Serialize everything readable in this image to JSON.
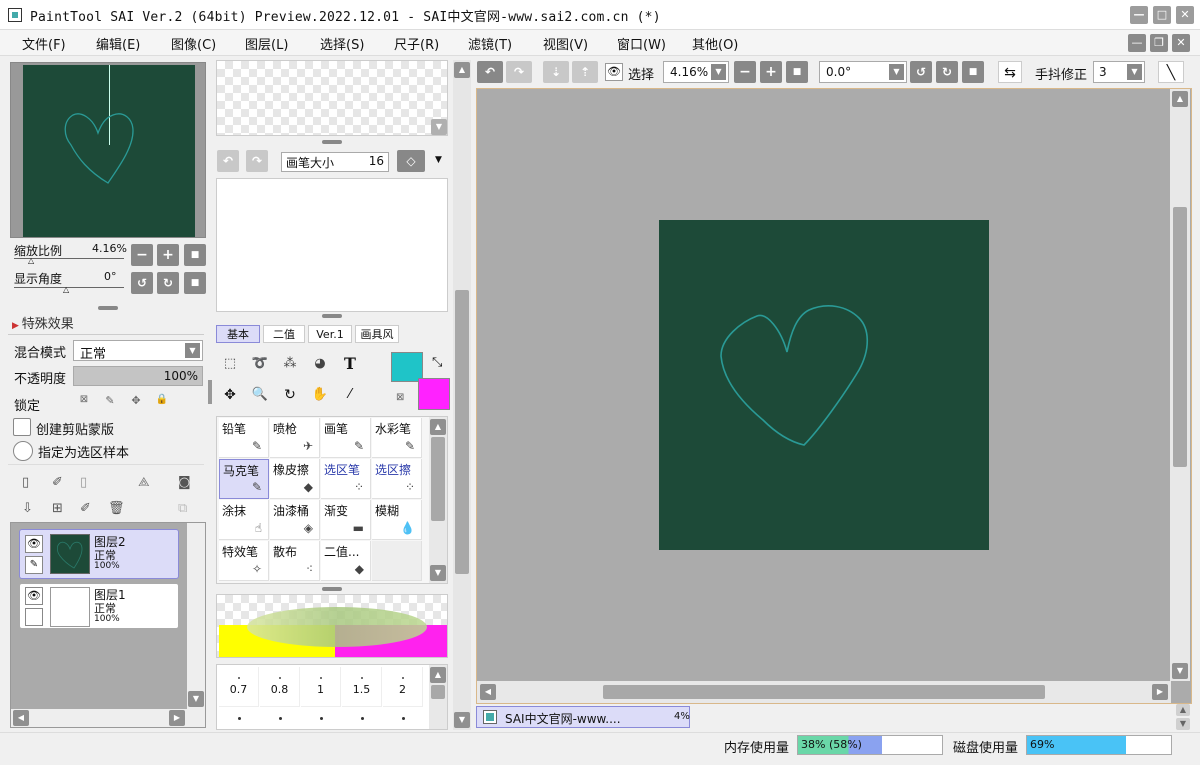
{
  "window": {
    "title": "PaintTool SAI Ver.2 (64bit) Preview.2022.12.01 - SAI中文官网-www.sai2.com.cn (*)"
  },
  "menu": {
    "items": [
      "文件(F)",
      "编辑(E)",
      "图像(C)",
      "图层(L)",
      "选择(S)",
      "尺子(R)",
      "滤镜(T)",
      "视图(V)",
      "窗口(W)",
      "其他(O)"
    ]
  },
  "navigator": {
    "zoom_label": "缩放比例",
    "zoom_value": "4.16%",
    "angle_label": "显示角度",
    "angle_value": "0°"
  },
  "layer_props": {
    "effects_label": "特殊效果",
    "blend_label": "混合模式",
    "blend_value": "正常",
    "opacity_label": "不透明度",
    "opacity_value": "100%",
    "lock_label": "锁定",
    "clip_label": "创建剪贴蒙版",
    "sample_label": "指定为选区样本"
  },
  "layers": [
    {
      "name": "图层2",
      "mode": "正常",
      "opacity": "100%",
      "selected": true
    },
    {
      "name": "图层1",
      "mode": "正常",
      "opacity": "100%",
      "selected": false
    }
  ],
  "brush": {
    "size_label": "画笔大小",
    "size_value": "16"
  },
  "tabs": [
    "基本",
    "二值",
    "Ver.1",
    "画具风"
  ],
  "colors": {
    "primary": "#1fc4c8",
    "secondary": "#ff22ff",
    "canvas": "#1d4a38",
    "heart": "#2a9a96"
  },
  "tools": [
    {
      "name": "铅笔",
      "icon": "✎"
    },
    {
      "name": "喷枪",
      "icon": "✈"
    },
    {
      "name": "画笔",
      "icon": "✎"
    },
    {
      "name": "水彩笔",
      "icon": "✎"
    },
    {
      "name": "马克笔",
      "icon": "✎",
      "selected": true
    },
    {
      "name": "橡皮擦",
      "icon": "◆"
    },
    {
      "name": "选区笔",
      "icon": "⁘",
      "blue": true
    },
    {
      "name": "选区擦",
      "icon": "⁘",
      "blue": true
    },
    {
      "name": "涂抹",
      "icon": "☝"
    },
    {
      "name": "油漆桶",
      "icon": "◈"
    },
    {
      "name": "渐变",
      "icon": "▬"
    },
    {
      "name": "模糊",
      "icon": "💧"
    },
    {
      "name": "特效笔",
      "icon": "✧"
    },
    {
      "name": "散布",
      "icon": "⁖"
    },
    {
      "name": "二值...",
      "icon": "◆"
    }
  ],
  "brush_sizes": [
    "0.7",
    "0.8",
    "1",
    "1.5",
    "2"
  ],
  "toolbar": {
    "select_label": "选择",
    "zoom_value": "4.16%",
    "angle_value": "0.0°",
    "stabilizer_label": "手抖修正",
    "stabilizer_value": "3"
  },
  "doc_tab": {
    "name": "SAI中文官网-www....",
    "zoom": "4%"
  },
  "status": {
    "memory_label": "内存使用量",
    "memory_value": "38% (58%)",
    "memory_fraction": 0.38,
    "disk_label": "磁盘使用量",
    "disk_value": "69%",
    "disk_fraction": 0.69
  }
}
